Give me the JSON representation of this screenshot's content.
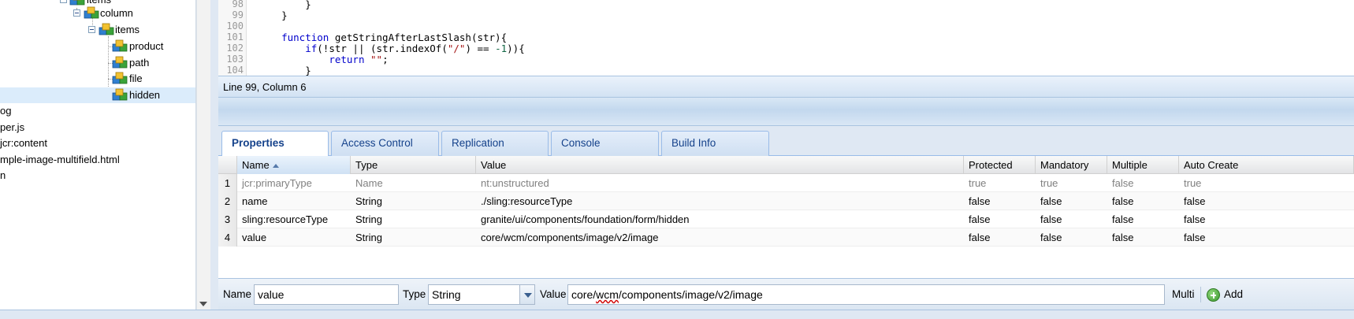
{
  "tree": {
    "nodes": [
      {
        "label": "items",
        "type": "folder-open"
      },
      {
        "label": "column",
        "type": "folder-open"
      },
      {
        "label": "items",
        "type": "folder-open"
      },
      {
        "label": "product",
        "type": "node"
      },
      {
        "label": "path",
        "type": "node"
      },
      {
        "label": "file",
        "type": "node"
      },
      {
        "label": "hidden",
        "type": "node",
        "selected": true
      },
      {
        "label": "og",
        "type": "file"
      },
      {
        "label": "per.js",
        "type": "file"
      },
      {
        "label": "jcr:content",
        "type": "file"
      },
      {
        "label": "mple-image-multifield.html",
        "type": "file"
      },
      {
        "label": "n",
        "type": "file"
      }
    ]
  },
  "editor": {
    "lines": [
      {
        "num": "98",
        "text": "        }"
      },
      {
        "num": "99",
        "text": "    }"
      },
      {
        "num": "100",
        "text": ""
      },
      {
        "num": "101",
        "text": "    function getStringAfterLastSlash(str){"
      },
      {
        "num": "102",
        "text": "        if(!str || (str.indexOf(\"/\") == -1)){"
      },
      {
        "num": "103",
        "text": "            return \"\";"
      },
      {
        "num": "104",
        "text": "        }"
      }
    ],
    "status": "Line 99, Column 6"
  },
  "tabs": [
    {
      "label": "Properties",
      "active": true
    },
    {
      "label": "Access Control",
      "active": false
    },
    {
      "label": "Replication",
      "active": false
    },
    {
      "label": "Console",
      "active": false
    },
    {
      "label": "Build Info",
      "active": false
    }
  ],
  "grid": {
    "columns": [
      "Name",
      "Type",
      "Value",
      "Protected",
      "Mandatory",
      "Multiple",
      "Auto Create"
    ],
    "sorted_column": "Name",
    "rows": [
      {
        "num": "1",
        "name": "jcr:primaryType",
        "type": "Name",
        "value": "nt:unstructured",
        "protected": "true",
        "mandatory": "true",
        "multiple": "false",
        "autocreate": "true",
        "readonly": true
      },
      {
        "num": "2",
        "name": "name",
        "type": "String",
        "value": "./sling:resourceType",
        "protected": "false",
        "mandatory": "false",
        "multiple": "false",
        "autocreate": "false"
      },
      {
        "num": "3",
        "name": "sling:resourceType",
        "type": "String",
        "value": "granite/ui/components/foundation/form/hidden",
        "protected": "false",
        "mandatory": "false",
        "multiple": "false",
        "autocreate": "false"
      },
      {
        "num": "4",
        "name": "value",
        "type": "String",
        "value": "core/wcm/components/image/v2/image",
        "protected": "false",
        "mandatory": "false",
        "multiple": "false",
        "autocreate": "false"
      }
    ]
  },
  "toolbar": {
    "name_label": "Name",
    "name_value": "value",
    "type_label": "Type",
    "type_value": "String",
    "value_label": "Value",
    "value_parts": [
      "core/",
      "wcm",
      "/components/image/v2/image"
    ],
    "multi_label": "Multi",
    "add_label": "Add"
  }
}
